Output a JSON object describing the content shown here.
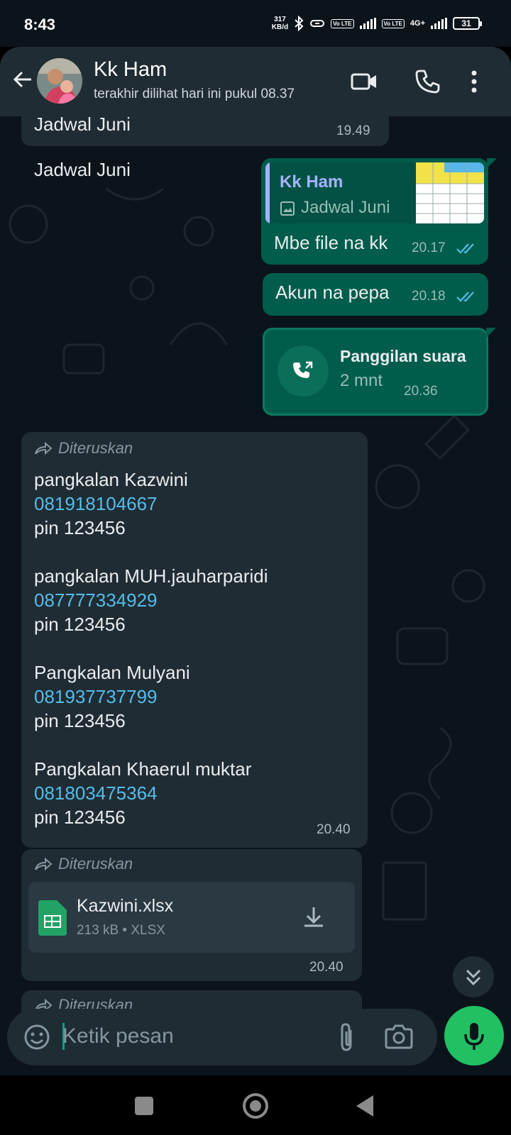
{
  "status_bar": {
    "time": "8:43",
    "speed_value": "317",
    "speed_unit": "KB/d",
    "volte1": "Vo LTE",
    "volte2": "Vo LTE",
    "network": "4G+",
    "battery": "31"
  },
  "header": {
    "contact_name": "Kk Ham",
    "contact_status": "terakhir dilihat hari ini pukul 08.37"
  },
  "messages": {
    "m1": {
      "text": "Jadwal Juni",
      "time": "19.49"
    },
    "m2": {
      "reply_name": "Kk Ham",
      "reply_text": "Jadwal Juni",
      "text": "Mbe file na kk",
      "time": "20.17"
    },
    "m3": {
      "text": "Akun na pepa",
      "time": "20.18"
    },
    "m4": {
      "title": "Panggilan suara",
      "duration": "2 mnt",
      "time": "20.36"
    },
    "m5": {
      "forwarded": "Diteruskan",
      "blocks": [
        {
          "name": "pangkalan Kazwini",
          "phone": "081918104667",
          "pin": "pin 123456"
        },
        {
          "name": "pangkalan MUH.jauharparidi",
          "phone": "087777334929",
          "pin": "pin 123456"
        },
        {
          "name": "Pangkalan Mulyani",
          "phone": "081937737799",
          "pin": "pin 123456"
        },
        {
          "name": "Pangkalan Khaerul muktar",
          "phone": "081803475364",
          "pin": "pin 123456"
        }
      ],
      "time": "20.40"
    },
    "m6": {
      "forwarded": "Diteruskan",
      "file_name": "Kazwini.xlsx",
      "file_meta": "213 kB • XLSX",
      "time": "20.40"
    },
    "m7": {
      "forwarded": "Diteruskan"
    }
  },
  "input": {
    "placeholder": "Ketik pesan"
  },
  "colors": {
    "header_bg": "#1f2c33",
    "incoming_bubble": "#202c33",
    "outgoing_bubble": "#005c4b",
    "link": "#53bdeb",
    "read_ticks": "#53bdeb",
    "mic_button": "#21c063"
  },
  "icons": [
    "back-arrow-icon",
    "video-call-icon",
    "voice-call-icon",
    "more-options-icon",
    "image-icon",
    "double-tick-icon",
    "call-icon",
    "forward-icon",
    "spreadsheet-icon",
    "download-icon",
    "scroll-down-icon",
    "emoji-icon",
    "attach-icon",
    "camera-icon",
    "mic-icon",
    "nav-recents-icon",
    "nav-home-icon",
    "nav-back-icon"
  ]
}
